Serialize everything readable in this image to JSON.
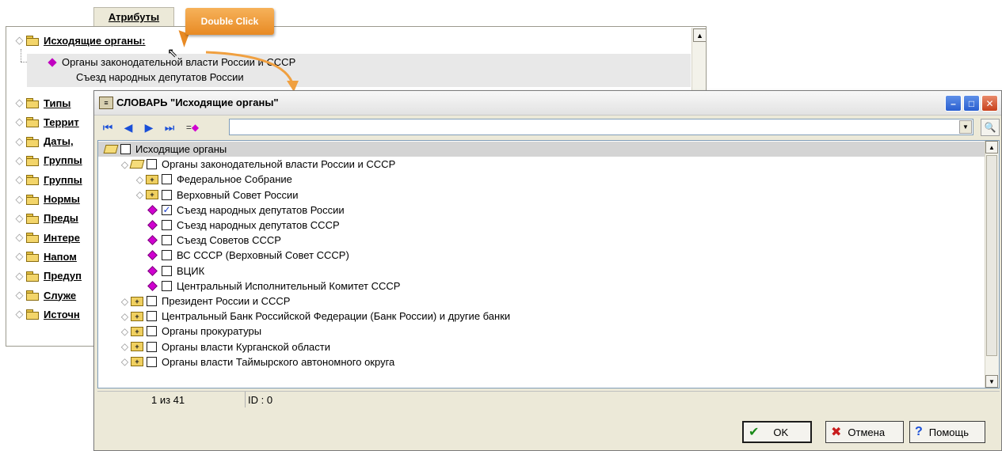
{
  "background": {
    "tab_label": "Атрибуты",
    "header_label": "Исходящие органы:",
    "sub_line1": "Органы законодательной власти России и СССР",
    "sub_line2": "Съезд народных депутатов России",
    "tree_items": [
      "Типы",
      "Террит",
      "Даты,",
      "Группы",
      "Группы",
      "Нормы",
      "Преды",
      "Интере",
      "Напом",
      "Предуп",
      "Служе",
      "Источн"
    ]
  },
  "callout": {
    "label": "Double Click"
  },
  "window": {
    "title": "СЛОВАРЬ \"Исходящие органы\"",
    "icon": "dictionary-icon",
    "controls": [
      "minimize",
      "maximize",
      "close"
    ],
    "search_value": "",
    "rows": [
      {
        "label": "Исходящие органы",
        "level": 0,
        "icon": "folder-open",
        "checked": false,
        "selected": true
      },
      {
        "label": "Органы законодательной власти России и СССР",
        "level": 1,
        "icon": "folder-open",
        "checked": false
      },
      {
        "label": "Федеральное Собрание",
        "level": 2,
        "icon": "folder-plus",
        "checked": false
      },
      {
        "label": "Верховный Совет России",
        "level": 2,
        "icon": "folder-plus",
        "checked": false
      },
      {
        "label": "Съезд народных депутатов России",
        "level": 2,
        "icon": "diamond",
        "checked": true
      },
      {
        "label": "Съезд народных депутатов СССР",
        "level": 2,
        "icon": "diamond",
        "checked": false
      },
      {
        "label": "Съезд Советов СССР",
        "level": 2,
        "icon": "diamond",
        "checked": false
      },
      {
        "label": "ВС СССР (Верховный Совет СССР)",
        "level": 2,
        "icon": "diamond",
        "checked": false
      },
      {
        "label": "ВЦИК",
        "level": 2,
        "icon": "diamond",
        "checked": false
      },
      {
        "label": "Центральный Исполнительный Комитет СССР",
        "level": 2,
        "icon": "diamond",
        "checked": false
      },
      {
        "label": "Президент России и СССР",
        "level": 1,
        "icon": "folder-plus",
        "checked": false
      },
      {
        "label": "Центральный Банк Российской Федерации (Банк России) и другие банки",
        "level": 1,
        "icon": "folder-plus",
        "checked": false
      },
      {
        "label": "Органы прокуратуры",
        "level": 1,
        "icon": "folder-plus",
        "checked": false
      },
      {
        "label": "Органы власти Курганской области",
        "level": 1,
        "icon": "folder-plus",
        "checked": false
      },
      {
        "label": "Органы власти Таймырского автономного округа",
        "level": 1,
        "icon": "folder-plus",
        "checked": false
      }
    ],
    "status_position": "1 из 41",
    "status_id": "ID : 0",
    "ok_label": "OK",
    "cancel_label": "Отмена",
    "help_label": "Помощь"
  }
}
